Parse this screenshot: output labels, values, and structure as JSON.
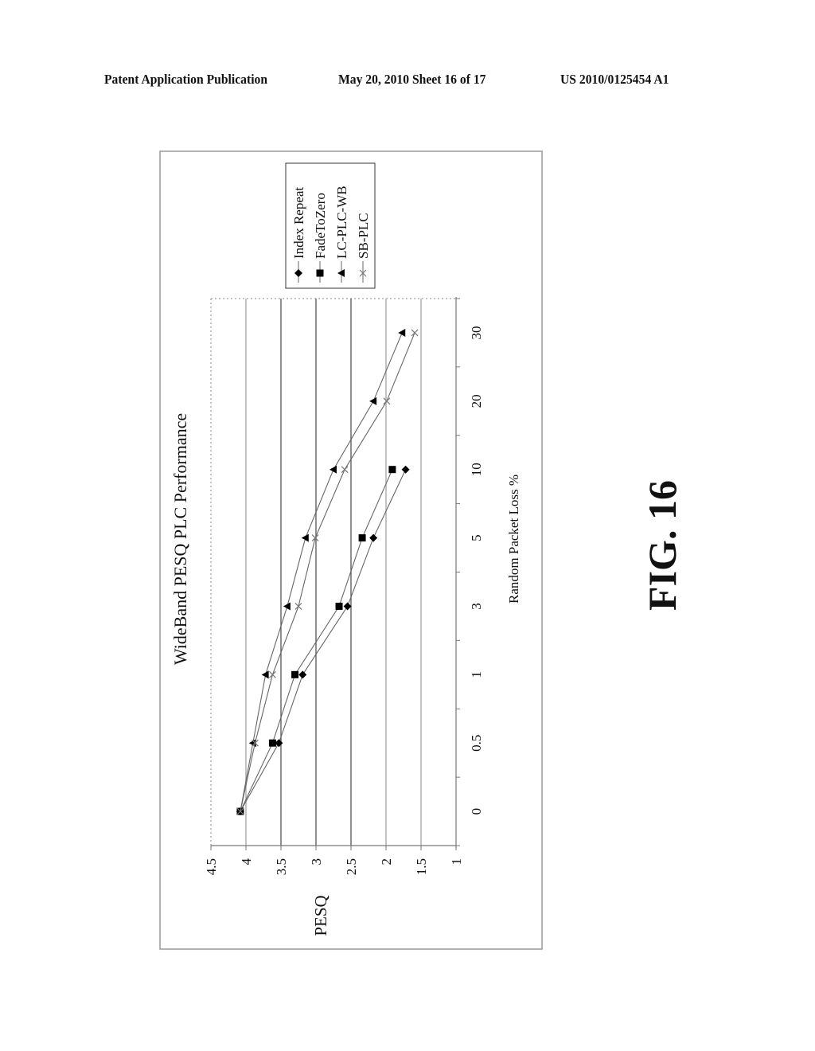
{
  "header": {
    "left": "Patent Application Publication",
    "middle": "May 20, 2010  Sheet 16 of 17",
    "right": "US 2010/0125454 A1"
  },
  "figure_label": "FIG. 16",
  "chart_data": {
    "type": "line",
    "orientation": "rotated-90-ccw",
    "title": "WideBand PESQ PLC Performance",
    "xlabel": "Random Packet Loss %",
    "ylabel": "PESQ",
    "categories": [
      "0",
      "0.5",
      "1",
      "3",
      "5",
      "10",
      "20",
      "30"
    ],
    "ylim": [
      1,
      4.5
    ],
    "yticks": [
      "4.5",
      "4",
      "3.5",
      "3",
      "2.5",
      "2",
      "1.5",
      "1"
    ],
    "ytick_values": [
      4.5,
      4,
      3.5,
      3,
      2.5,
      2,
      1.5,
      1
    ],
    "grid": true,
    "legend_position": "top-right",
    "series": [
      {
        "name": "Index Repeat",
        "marker": "diamond",
        "color": "#000000",
        "values": [
          4.08,
          3.53,
          3.19,
          2.55,
          2.18,
          1.72,
          null,
          null
        ]
      },
      {
        "name": "FadeToZero",
        "marker": "square",
        "color": "#000000",
        "values": [
          4.08,
          3.62,
          3.3,
          2.67,
          2.34,
          1.91,
          null,
          null
        ]
      },
      {
        "name": "LC-PLC-WB",
        "marker": "triangle",
        "color": "#000000",
        "values": [
          4.08,
          3.9,
          3.72,
          3.41,
          3.15,
          2.75,
          2.18,
          1.77
        ]
      },
      {
        "name": "SB-PLC",
        "marker": "x",
        "color": "#777777",
        "values": [
          4.08,
          3.87,
          3.62,
          3.25,
          3.01,
          2.59,
          1.99,
          1.59
        ]
      }
    ]
  }
}
